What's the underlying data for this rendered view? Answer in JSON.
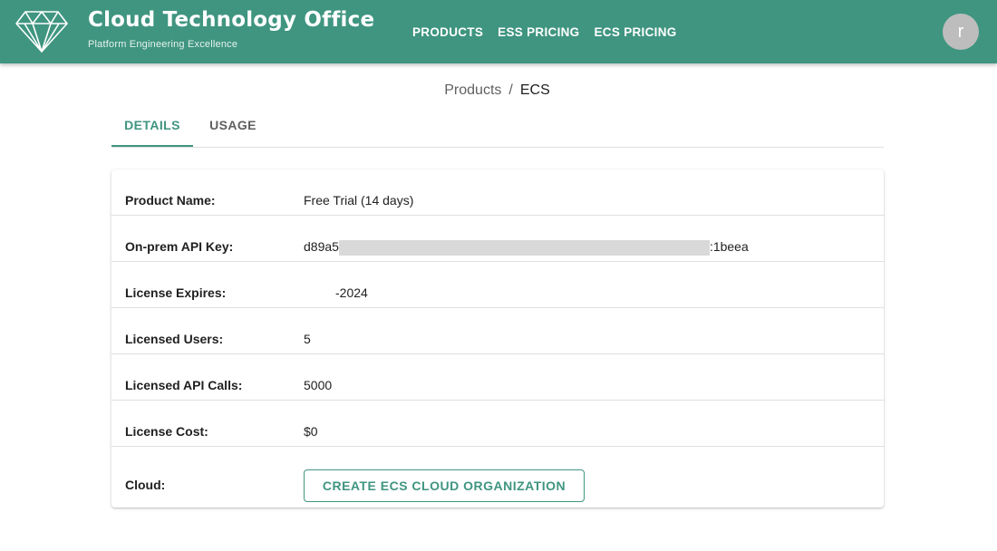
{
  "header": {
    "title": "Cloud Technology Office",
    "subtitle": "Platform Engineering Excellence",
    "logo_icon": "diamond-icon",
    "nav": [
      {
        "label": "PRODUCTS"
      },
      {
        "label": "ESS PRICING"
      },
      {
        "label": "ECS PRICING"
      }
    ],
    "avatar_initial": "r",
    "brand_color": "#3f9580"
  },
  "breadcrumb": {
    "parent": "Products",
    "separator": "/",
    "current": "ECS"
  },
  "tabs": [
    {
      "label": "DETAILS",
      "active": true
    },
    {
      "label": "USAGE",
      "active": false
    }
  ],
  "details": {
    "product_name": {
      "label": "Product Name:",
      "value": "Free Trial (14 days)"
    },
    "api_key": {
      "label": "On-prem API Key:",
      "value_start": "d89a5",
      "value_end": ":1beea",
      "redacted": true
    },
    "license_expires": {
      "label": "License Expires:",
      "value": "-2024",
      "partially_redacted": true
    },
    "licensed_users": {
      "label": "Licensed Users:",
      "value": "5"
    },
    "licensed_api_calls": {
      "label": "Licensed API Calls:",
      "value": "5000"
    },
    "license_cost": {
      "label": "License Cost:",
      "value": "$0"
    },
    "cloud": {
      "label": "Cloud:",
      "button_label": "CREATE ECS CLOUD ORGANIZATION"
    }
  }
}
